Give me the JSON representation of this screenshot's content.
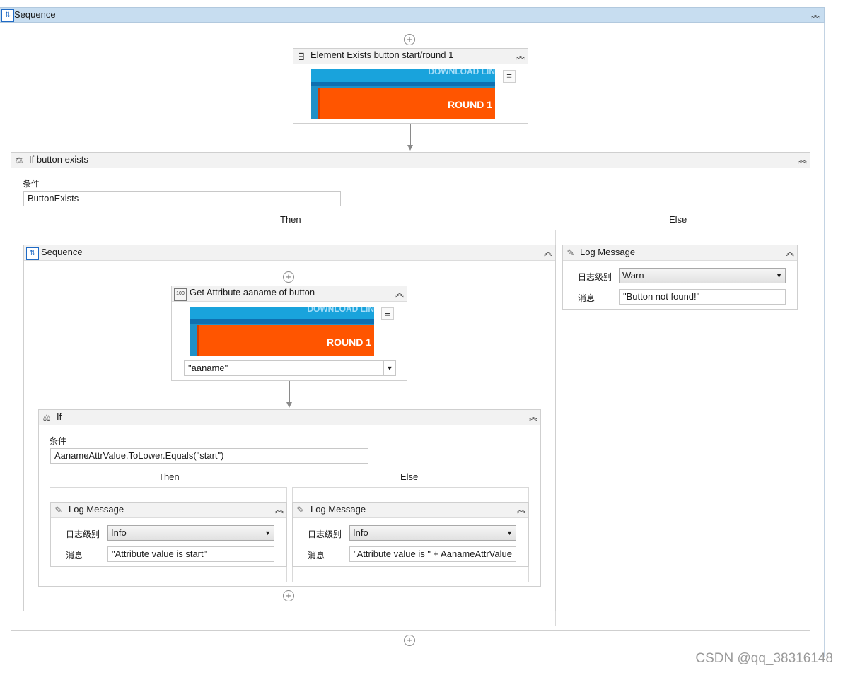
{
  "root_sequence": {
    "title": "Sequence",
    "icon": "sequence-icon",
    "collapse_glyph": "⌃"
  },
  "element_exists": {
    "title": "Element Exists button start/round 1",
    "icon": "element-exists-icon",
    "thumbnail_text": "ROUND 1",
    "thumbnail_ghost": "DOWNLOAD LIN"
  },
  "if_button": {
    "title": "If button exists",
    "condition_label": "条件",
    "condition_value": "ButtonExists",
    "then_label": "Then",
    "else_label": "Else"
  },
  "then_sequence": {
    "title": "Sequence"
  },
  "get_attribute": {
    "title": "Get Attribute aaname of button",
    "thumbnail_text": "ROUND 1",
    "thumbnail_ghost": "DOWNLOAD LIN",
    "attribute_value": "\"aaname\""
  },
  "inner_if": {
    "title": "If",
    "condition_label": "条件",
    "condition_value": "AanameAttrValue.ToLower.Equals(\"start\")",
    "then_label": "Then",
    "else_label": "Else"
  },
  "log_then": {
    "title": "Log Message",
    "level_label": "日志级别",
    "level_value": "Info",
    "message_label": "消息",
    "message_value": "\"Attribute value is start\""
  },
  "log_else_inner": {
    "title": "Log Message",
    "level_label": "日志级别",
    "level_value": "Info",
    "message_label": "消息",
    "message_value": "\"Attribute value is \" + AanameAttrValue"
  },
  "log_else_outer": {
    "title": "Log Message",
    "level_label": "日志级别",
    "level_value": "Warn",
    "message_label": "消息",
    "message_value": "\"Button not found!\""
  },
  "watermark": "CSDN @qq_38316148",
  "colors": {
    "header_blue": "#c7ddf0",
    "thumb_orange": "#ff5500",
    "thumb_blue": "#19a3dc"
  }
}
